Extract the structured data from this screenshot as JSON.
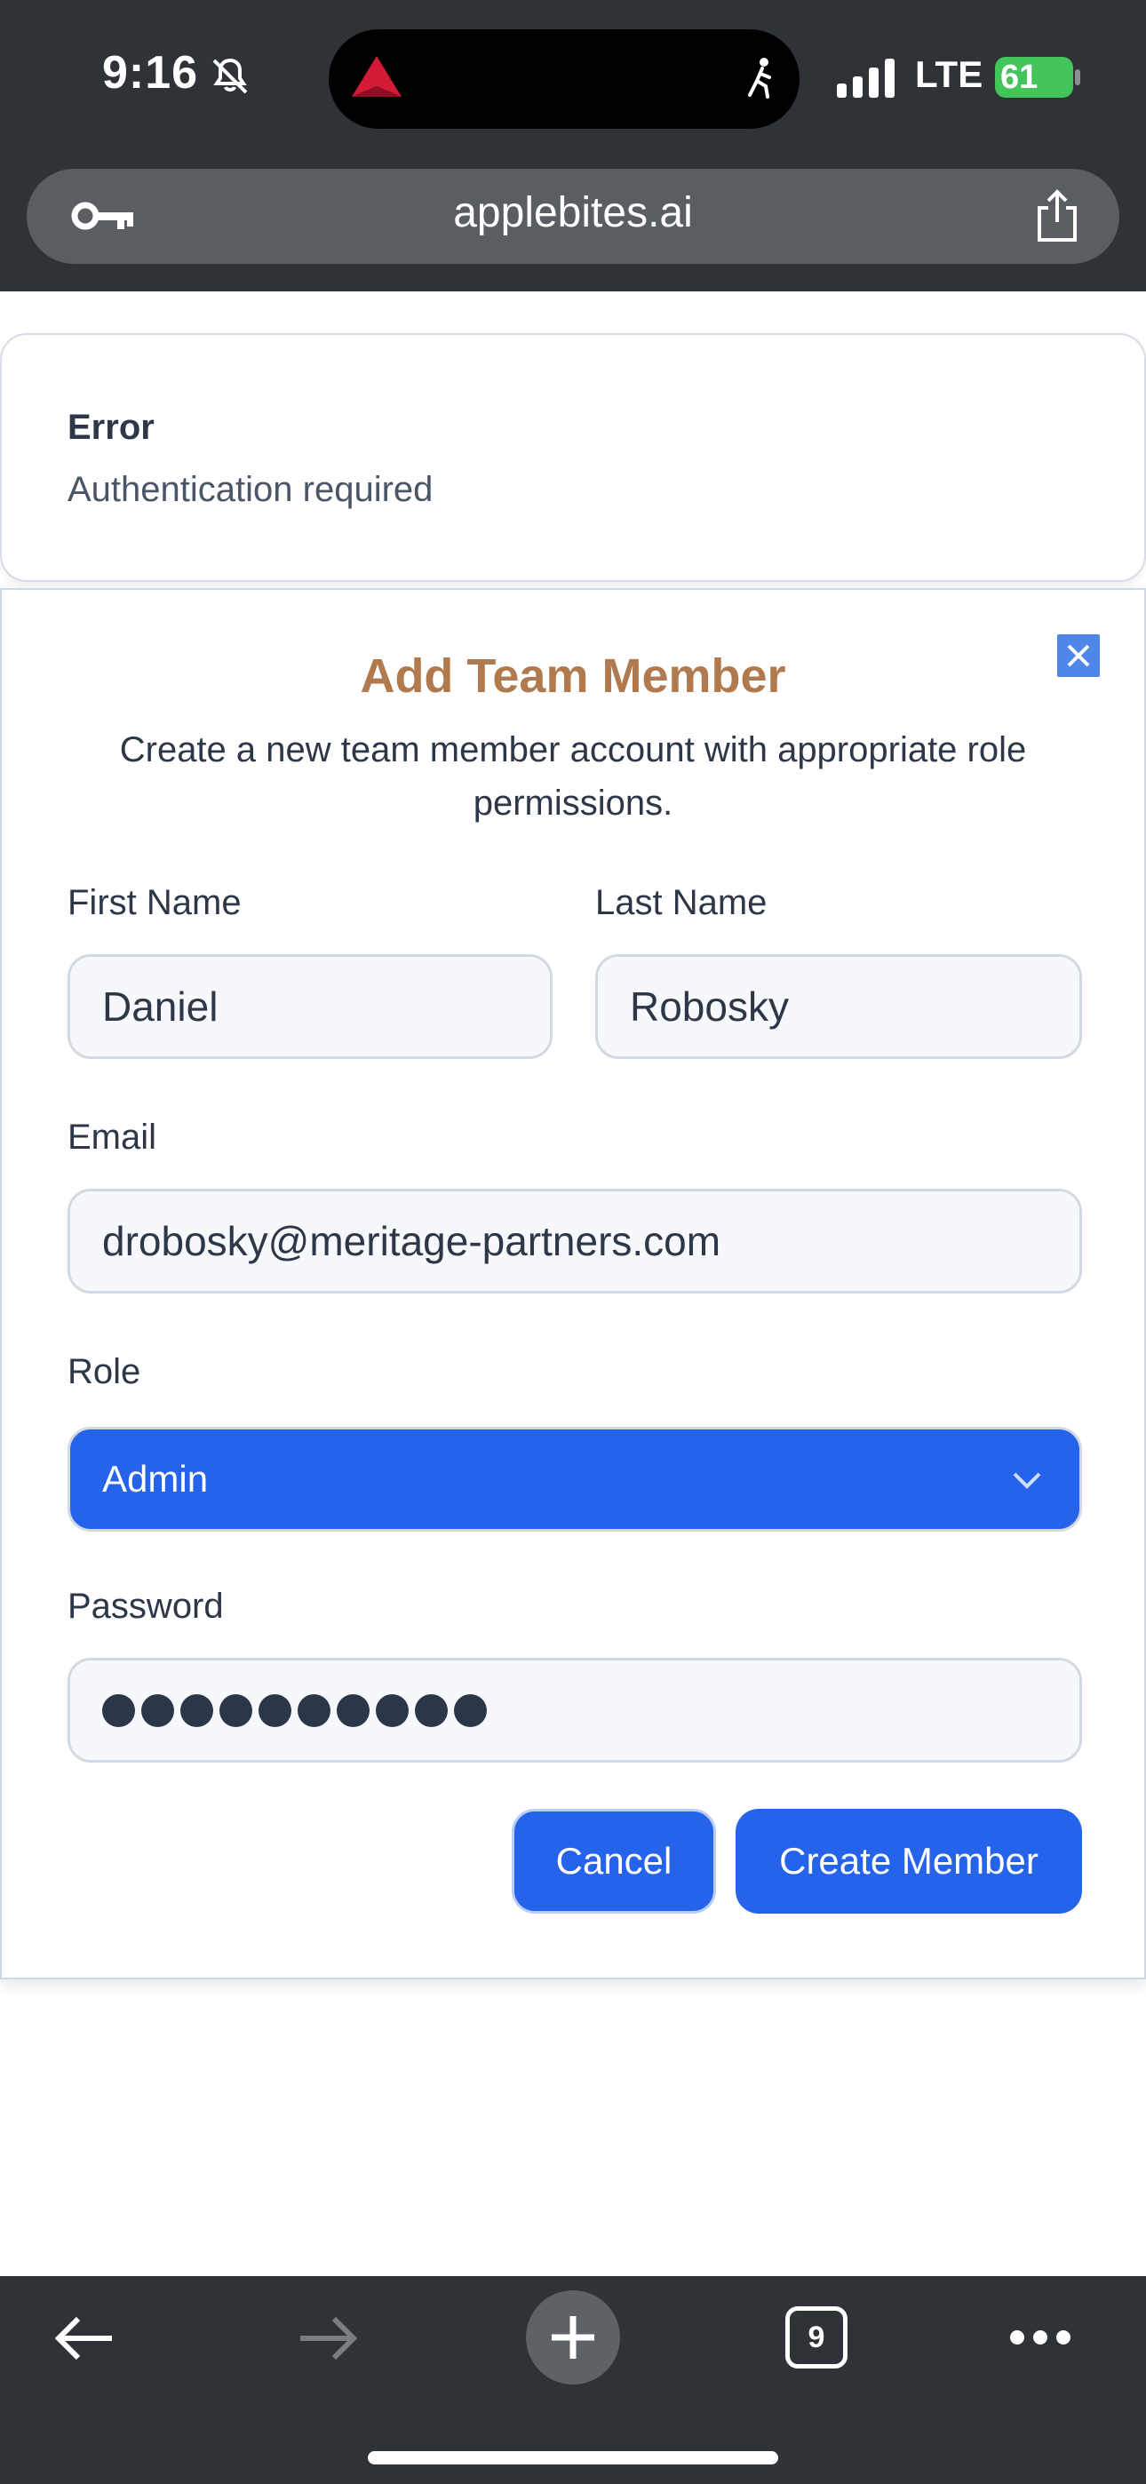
{
  "status_bar": {
    "time": "9:16",
    "network": "LTE",
    "battery": "61"
  },
  "browser": {
    "url": "applebites.ai",
    "open_tabs": "9"
  },
  "error": {
    "title": "Error",
    "message": "Authentication required"
  },
  "dialog": {
    "title": "Add Team Member",
    "description": "Create a new team member account with appropriate role permissions.",
    "first_name_label": "First Name",
    "first_name_value": "Daniel",
    "last_name_label": "Last Name",
    "last_name_value": "Robosky",
    "email_label": "Email",
    "email_value": "drobosky@meritage-partners.com",
    "role_label": "Role",
    "role_value": "Admin",
    "password_label": "Password",
    "password_length": 10,
    "cancel_label": "Cancel",
    "create_label": "Create Member"
  },
  "colors": {
    "accent": "#2563eb",
    "title": "#b07a4e",
    "chrome": "#2f3236"
  }
}
